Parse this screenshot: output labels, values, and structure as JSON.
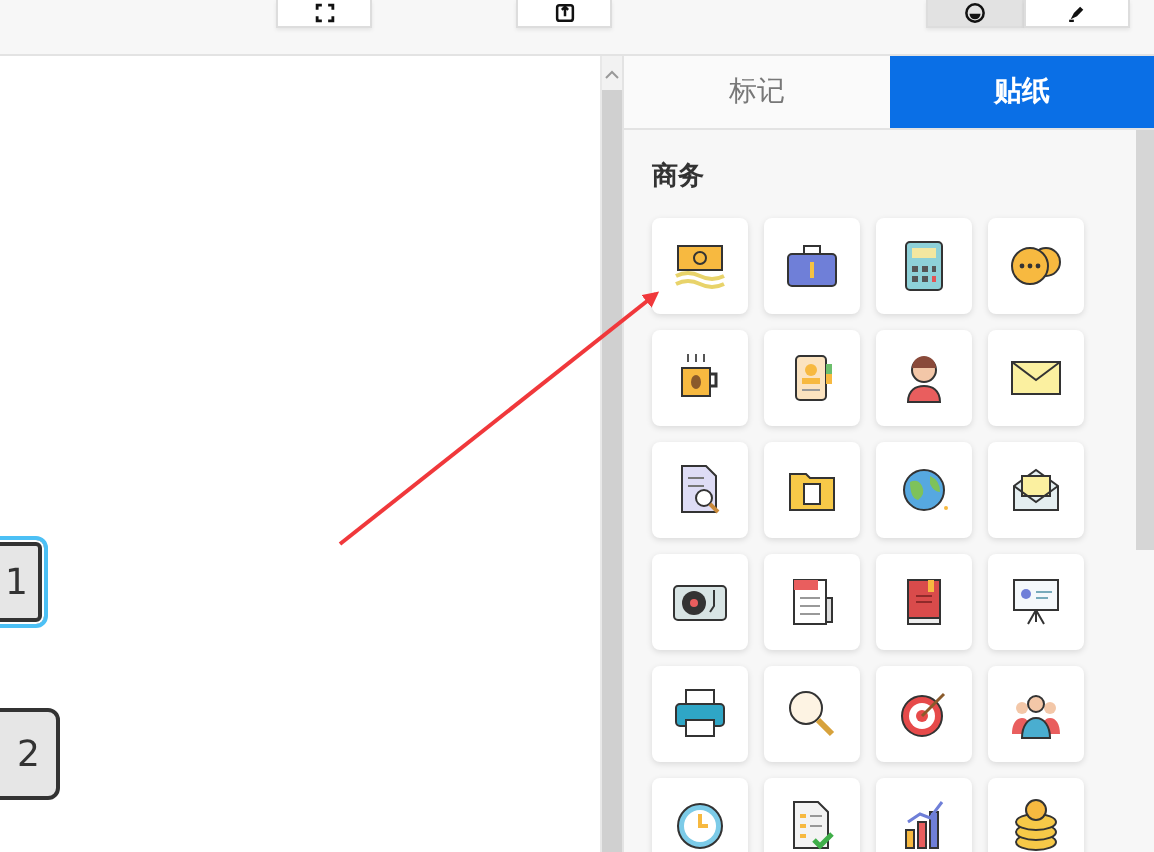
{
  "toolbar_buttons": [
    {
      "selected": false
    },
    {
      "selected": false
    },
    {
      "selected": true
    },
    {
      "selected": false
    }
  ],
  "canvas_nodes": [
    {
      "label": "1",
      "selected": true
    },
    {
      "label": "2",
      "selected": false
    }
  ],
  "tabs": [
    {
      "label": "标记",
      "selected": false
    },
    {
      "label": "贴纸",
      "selected": true
    }
  ],
  "sticker_section": {
    "title": "商务"
  }
}
